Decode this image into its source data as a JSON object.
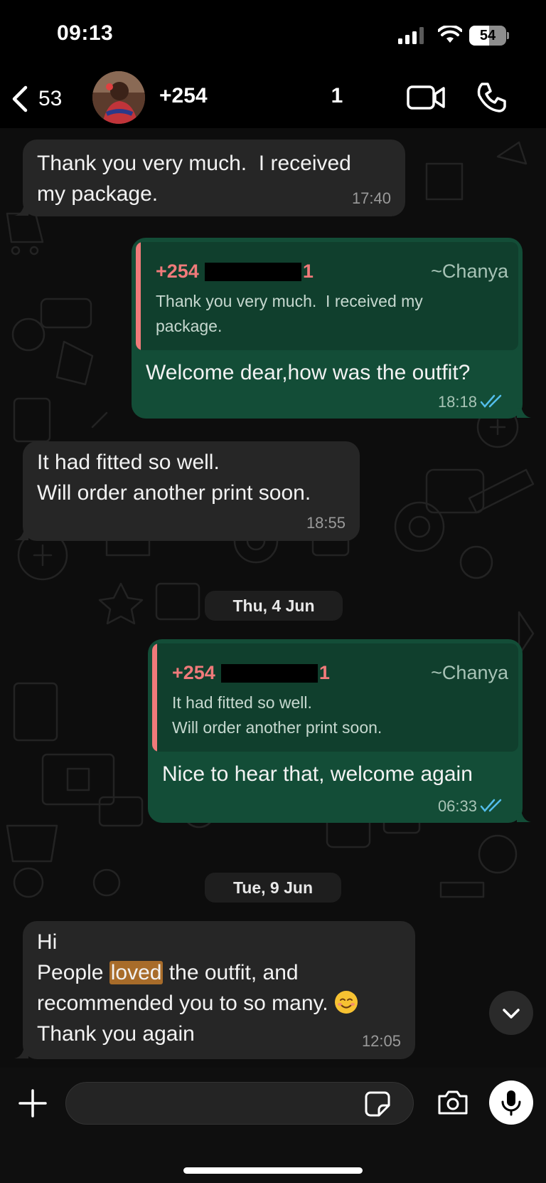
{
  "status_bar": {
    "time": "09:13",
    "battery": "54",
    "battery_level": 0.54,
    "icons": [
      "signal-icon",
      "wifi-icon",
      "battery-icon"
    ]
  },
  "header": {
    "back_count": "53",
    "contact_prefix": "+254",
    "contact_suffix": "1",
    "icons": [
      "chevron-left-icon",
      "video-camera-icon",
      "phone-icon"
    ]
  },
  "messages": [
    {
      "direction": "incoming",
      "text": "Thank you very much.  I received\nmy package.",
      "time": "17:40"
    },
    {
      "direction": "outgoing",
      "quote": {
        "sender_prefix": "+254",
        "sender_suffix": "1",
        "alias": "~Chanya",
        "text": "Thank you very much.  I received my\npackage."
      },
      "text": "Welcome dear,how was the outfit?",
      "time": "18:18",
      "status": "read"
    },
    {
      "direction": "incoming",
      "text": "It had fitted so well.\nWill order another print soon.",
      "time": "18:55"
    },
    {
      "direction": "outgoing",
      "quote": {
        "sender_prefix": "+254",
        "sender_suffix": "1",
        "alias": "~Chanya",
        "text": "It had fitted so well.\nWill order another print soon."
      },
      "text": "Nice to hear that, welcome again",
      "time": "06:33",
      "status": "read"
    },
    {
      "direction": "incoming",
      "lines": {
        "l1": "Hi",
        "l2_before": "People ",
        "l2_highlight": "loved",
        "l2_after": " the outfit, and",
        "l3": "recommended you to so many. ",
        "l4": "Thank you again"
      },
      "emoji": "smiling-face-emoji",
      "time": "12:05"
    }
  ],
  "date_separators": [
    "Thu, 4 Jun",
    "Tue, 9 Jun"
  ],
  "composer": {
    "placeholder": "",
    "icons": [
      "plus-icon",
      "sticker-icon",
      "camera-icon",
      "microphone-icon"
    ]
  },
  "colors": {
    "incoming_bubble": "#262626",
    "outgoing_bubble": "#134d37",
    "quote_accent": "#f07a7a",
    "read_ticks": "#53bdeb",
    "highlight": "#a86c2a"
  }
}
